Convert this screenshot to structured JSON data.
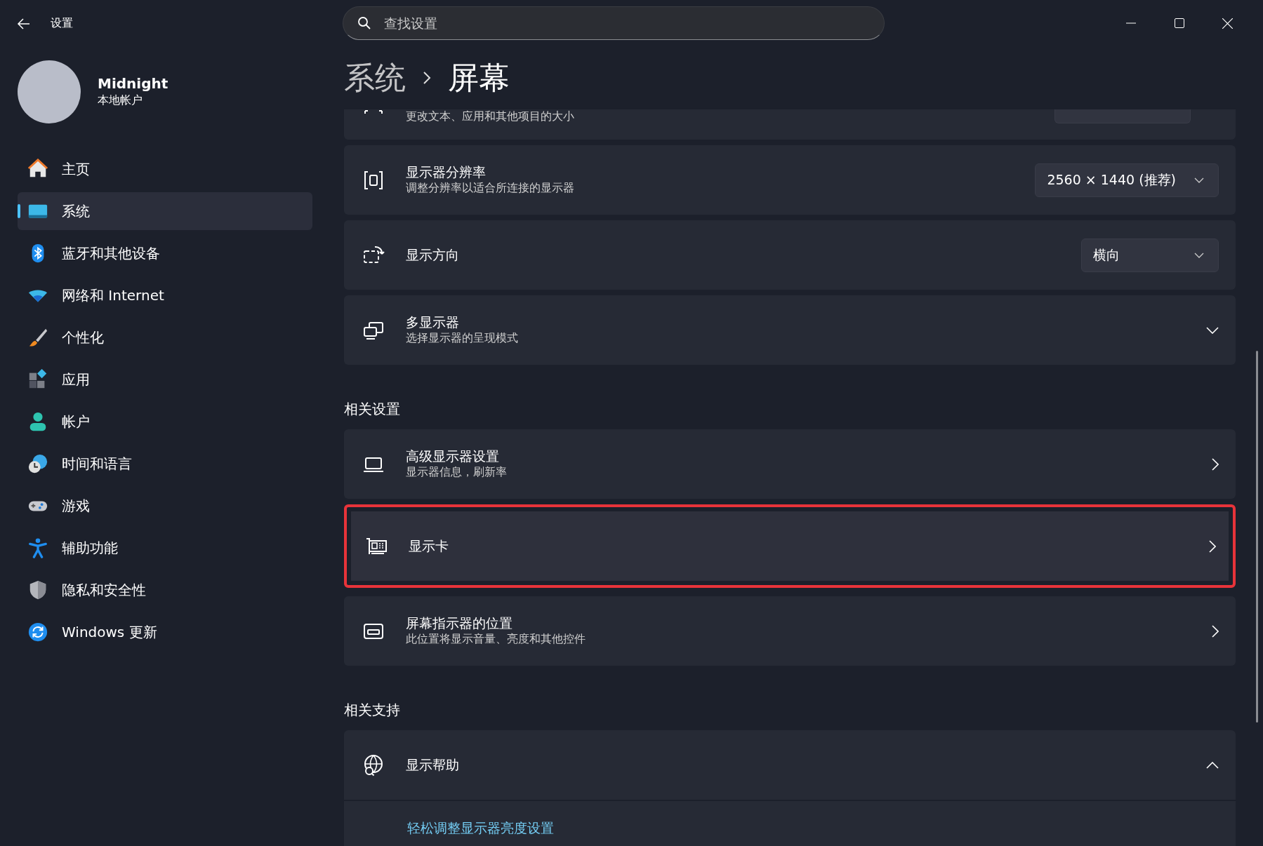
{
  "window": {
    "title": "设置"
  },
  "search": {
    "placeholder": "查找设置"
  },
  "account": {
    "name": "Midnight",
    "type": "本地帐户"
  },
  "sidebar": {
    "items": [
      {
        "label": "主页",
        "selected": false
      },
      {
        "label": "系统",
        "selected": true
      },
      {
        "label": "蓝牙和其他设备",
        "selected": false
      },
      {
        "label": "网络和 Internet",
        "selected": false
      },
      {
        "label": "个性化",
        "selected": false
      },
      {
        "label": "应用",
        "selected": false
      },
      {
        "label": "帐户",
        "selected": false
      },
      {
        "label": "时间和语言",
        "selected": false
      },
      {
        "label": "游戏",
        "selected": false
      },
      {
        "label": "辅助功能",
        "selected": false
      },
      {
        "label": "隐私和安全性",
        "selected": false
      },
      {
        "label": "Windows 更新",
        "selected": false
      }
    ]
  },
  "breadcrumb": [
    "系统",
    "屏幕"
  ],
  "display_rows": [
    {
      "kind": "partial",
      "subtitle": "更改文本、应用和其他项目的大小"
    },
    {
      "kind": "dropdown",
      "title": "显示器分辨率",
      "subtitle": "调整分辨率以适合所连接的显示器",
      "value": "2560 × 1440 (推荐)"
    },
    {
      "kind": "dropdown",
      "title": "显示方向",
      "value": "横向"
    },
    {
      "kind": "expander",
      "title": "多显示器",
      "subtitle": "选择显示器的呈现模式",
      "expanded": false
    }
  ],
  "related_settings": {
    "heading": "相关设置",
    "rows": [
      {
        "kind": "link",
        "title": "高级显示器设置",
        "subtitle": "显示器信息，刷新率",
        "highlighted": false
      },
      {
        "kind": "link",
        "title": "显示卡",
        "highlighted": true
      },
      {
        "kind": "link",
        "title": "屏幕指示器的位置",
        "subtitle": "此位置将显示音量、亮度和其他控件",
        "highlighted": false
      }
    ]
  },
  "related_support": {
    "heading": "相关支持",
    "rows": [
      {
        "kind": "expander",
        "title": "显示帮助",
        "expanded": true,
        "links": [
          "轻松调整显示器亮度设置"
        ]
      }
    ]
  }
}
